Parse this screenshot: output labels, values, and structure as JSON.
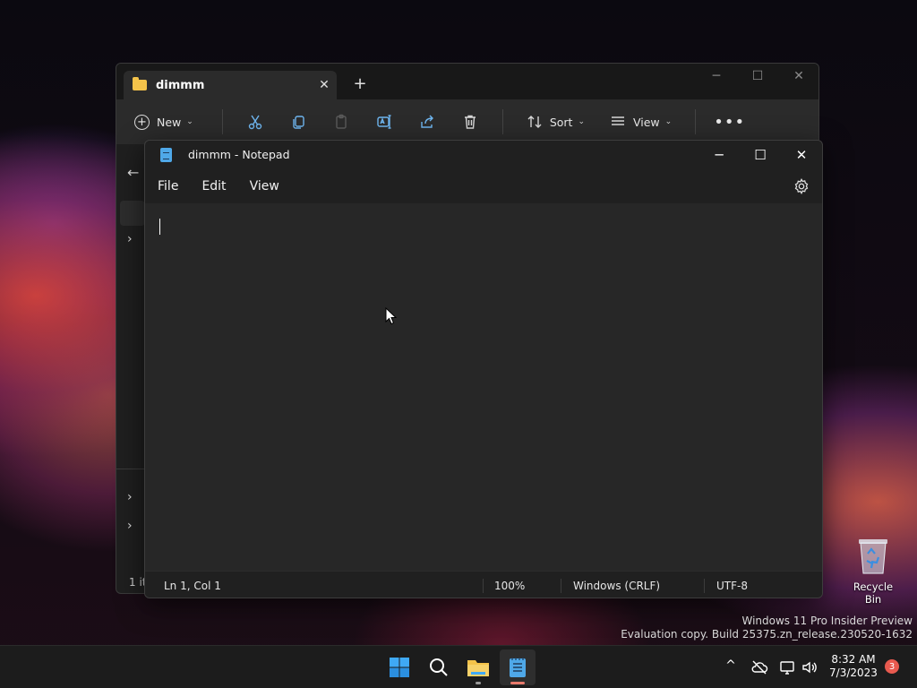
{
  "explorer": {
    "tab_title": "dimmm",
    "tab_close": "✕",
    "new_tab": "+",
    "caption": {
      "minimize": "─",
      "maximize": "☐",
      "close": "✕"
    },
    "toolbar": {
      "new_label": "New",
      "sort_label": "Sort",
      "view_label": "View",
      "more": "•••"
    },
    "status_text": "1 it"
  },
  "notepad": {
    "title": "dimmm - Notepad",
    "caption": {
      "minimize": "─",
      "maximize": "☐",
      "close": "✕"
    },
    "menu": [
      "File",
      "Edit",
      "View"
    ],
    "content": "",
    "status": {
      "position": "Ln 1, Col 1",
      "zoom": "100%",
      "line_ending": "Windows (CRLF)",
      "encoding": "UTF-8"
    }
  },
  "desktop": {
    "recycle_bin_label": "Recycle Bin",
    "watermark_line1": "Windows 11 Pro Insider Preview",
    "watermark_line2": "Evaluation copy. Build 25375.zn_release.230520-1632"
  },
  "taskbar": {
    "apps": [
      "start-icon",
      "search-icon",
      "file-explorer-icon",
      "notepad-icon"
    ],
    "time": "8:32 AM",
    "date": "7/3/2023",
    "notification_count": "3",
    "tray_chevron": "^"
  },
  "colors": {
    "accent": "#4fa8e8",
    "folder": "#f4c34a",
    "notification_badge": "#e85a4f",
    "taskbar_indicator": "#e87a6c"
  }
}
